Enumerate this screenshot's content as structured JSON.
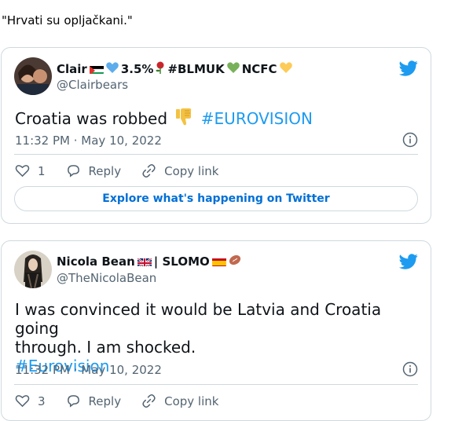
{
  "caption": "\"Hrvati su opljačkani.\"",
  "tweets": [
    {
      "name": "Clair",
      "name_suffix": "3.5%",
      "name_tag1": "#BLMUK",
      "name_tag2": "NCFC",
      "handle": "@Clairbears",
      "text": "Croatia was robbed",
      "hashtag": "#EUROVISION",
      "timestamp": "11:32 PM · May 10, 2022",
      "likes": "1",
      "reply_label": "Reply",
      "copy_label": "Copy link",
      "explore_label": "Explore what's happening on Twitter"
    },
    {
      "name": "Nicola Bean",
      "name_suffix": "| SLOMO",
      "handle": "@TheNicolaBean",
      "text_line1": "I was convinced it would be Latvia and Croatia going",
      "text_line2": "through. I am shocked.",
      "hashtag": "#Eurovision",
      "timestamp": "11:32 PM · May 10, 2022",
      "likes": "3",
      "reply_label": "Reply",
      "copy_label": "Copy link"
    }
  ],
  "colors": {
    "link": "#1d9bf0",
    "secondary": "#536471",
    "border": "#cfd9de"
  }
}
